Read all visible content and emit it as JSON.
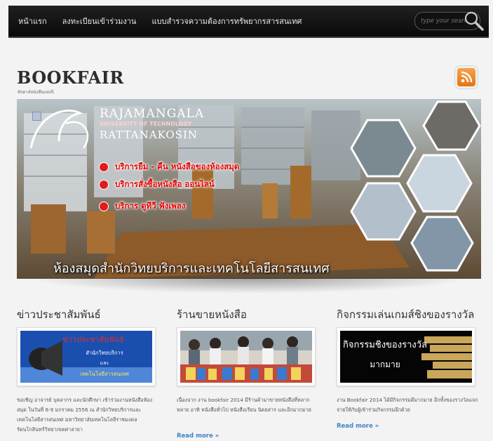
{
  "nav": {
    "items": [
      "หน้าแรก",
      "ลงทะเบียนเข้าร่วมงาน",
      "แบบสำรวจความต้องการทรัพยากรสารสนเทศ"
    ]
  },
  "search": {
    "placeholder": "type your search"
  },
  "header": {
    "logo": "BOOKFAIR",
    "tagline": "สัปดาห์หนังสือแห่งปี"
  },
  "banner": {
    "university_line1": "RAJAMANGALA",
    "university_line2": "UNIVERSITY OF TECHNOLOGY",
    "university_line3": "RATTANAKOSIN",
    "services": [
      "บริการยืม - คืน หนังสือของห้องสมุด",
      "บริการสั่งซื้อหนังสือ ออนไลน์",
      "บริการ ดูทีวี ฟังเพลง"
    ],
    "caption": "ห้องสมุดสำนักวิทยบริการและเทคโนโลยีสารสนเทศ"
  },
  "columns": [
    {
      "title": "ข่าวประชาสัมพันธ์",
      "image_text": [
        "ข่าวประชาสัมพันธ์",
        "สำนักวิทยบริการ",
        "และ",
        "เทคโนโลยีสารสนเทศ"
      ],
      "excerpt": "ขอเชิญ อาจารย์ บุคลากร และนักศึกษา เข้าร่วมงานหนังสือห้องสมุด ในวันที่ 8-9 มกราคม 2556 ณ สำนักวิทยบริการและเทคโนโลยีสารสนเทศ มหาวิทยาลัยเทคโนโลยีราชมงคลรัตนโกสินทร์วิทยาเขตศาลายา",
      "read_more": ""
    },
    {
      "title": "ร้านขายหนังสือ",
      "image_text": [],
      "excerpt": "เนื่องจาก งาน bookfair 2014 มีร้านค้ามาขายหนังสือที่หลากหลาย อาทิ หนังสือทั่วไป หนังสือเรียน นิตยสาร และอีกมากมาย",
      "read_more": "Read more »"
    },
    {
      "title": "กิจกรรมเล่นเกมส์ชิงของรางวัล",
      "image_text": [
        "กิจกรรมชิงของรางวัล",
        "มากมาย"
      ],
      "excerpt": "งาน Bookfair 2014 ได้มีกิจกรรมดีมากมาย อีกทั้งของรางวัลแจกจ่ายให้กับผู้เข้าร่วมกิจกรรมอีกด้วย",
      "read_more": "Read more »"
    }
  ],
  "colors": {
    "topbar": "#111111",
    "link": "#3f84c5",
    "accent_red": "#e21b1b",
    "rss": "#f08a2a"
  },
  "icons": [
    "search-icon",
    "rss-icon"
  ]
}
